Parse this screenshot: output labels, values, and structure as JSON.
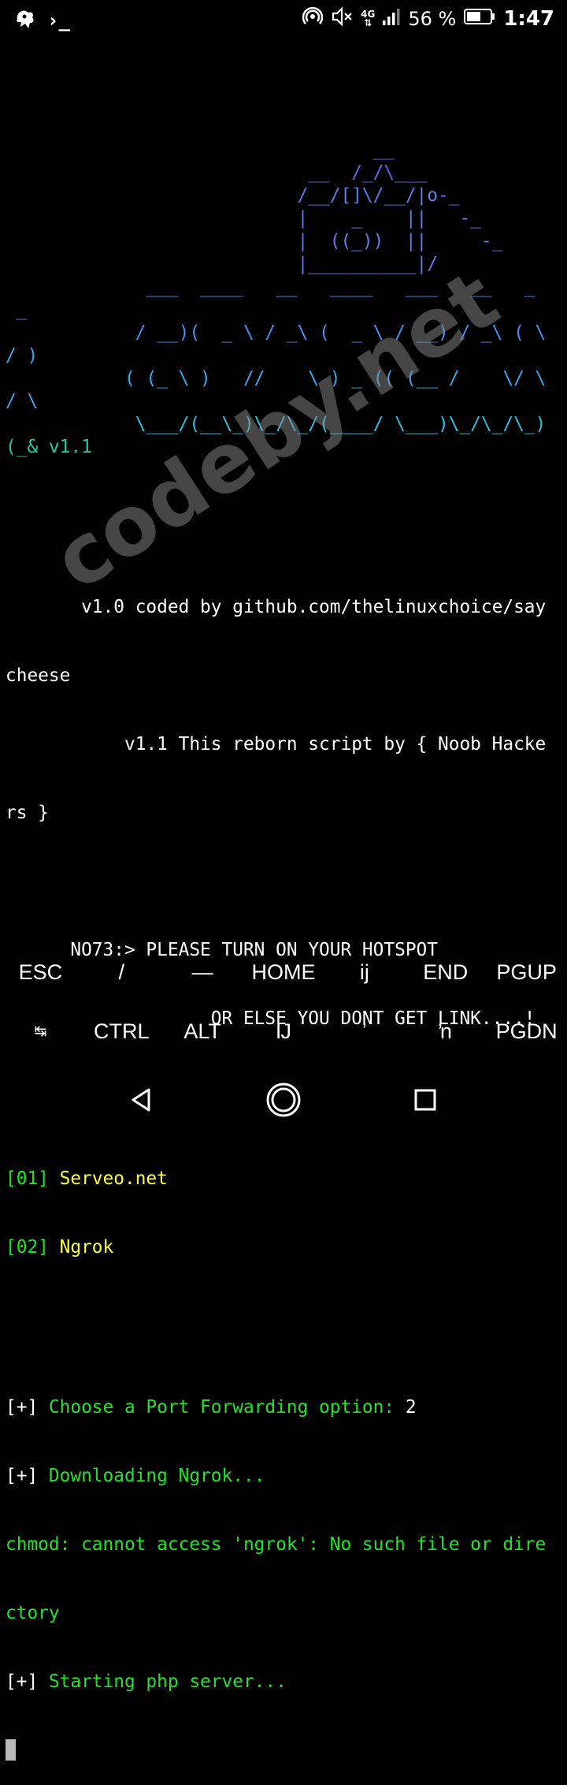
{
  "status_bar": {
    "network_top": "4G",
    "network_bottom": "⇅",
    "battery_percent": "56 %",
    "time": "1:47",
    "prompt_glyph": "›_"
  },
  "ascii_art": [
    {
      "text": "                                  __",
      "cls": "art-purple"
    },
    {
      "text": "                            __  /_/\\___",
      "cls": "art-purple"
    },
    {
      "text": "                           /__/[]\\/__/|o-_",
      "cls": "art-blue"
    },
    {
      "text": "                           |    _    ||   -_",
      "cls": "art-blue"
    },
    {
      "text": "                           |  ((_))  ||     -_",
      "cls": "art-blue"
    },
    {
      "text": "                           |__________|/",
      "cls": "art-blue"
    },
    {
      "text": "             ___  ____   __   ____   ___   __   _",
      "cls": "art-cyan1"
    },
    {
      "text": " _",
      "cls": "art-cyan1"
    },
    {
      "text": "            / __)(  _ \\ / _\\ (  _ \\ / __) / _\\ ( \\",
      "cls": "art-cyan1"
    },
    {
      "text": "/ )",
      "cls": "art-cyan2"
    },
    {
      "text": "           ( (_ \\ )   //    \\ ) _ (( (__ /    \\/ \\",
      "cls": "art-cyan2"
    },
    {
      "text": "/ \\",
      "cls": "art-cyan2"
    },
    {
      "text": "            \\___/(__\\_)\\_/\\_/(____/ \\___)\\_/\\_/\\_)",
      "cls": "art-cyan3"
    },
    {
      "text": "(_& v1.1",
      "cls": "teal"
    }
  ],
  "credits": [
    "       v1.0 coded by github.com/thelinuxchoice/say",
    "cheese",
    "           v1.1 This reborn script by { Noob Hacke",
    "rs }"
  ],
  "notice": [
    "      NO73:> PLEASE TURN ON YOUR HOTSPOT",
    "                   OR ELSE YOU DONT GET LINK....!"
  ],
  "menu": [
    {
      "num": "[01]",
      "label": " Serveo.net"
    },
    {
      "num": "[02]",
      "label": " Ngrok"
    }
  ],
  "log": {
    "choose_prefix": "[+]",
    "choose_text": " Choose a Port Forwarding option: ",
    "choose_value": "2",
    "download_prefix": "[+]",
    "download_text": " Downloading Ngrok...",
    "error_line1": "chmod: cannot access 'ngrok': No such file or dire",
    "error_line2": "ctory",
    "start_prefix": "[+]",
    "start_text": " Starting php server..."
  },
  "watermark": "codeby.net",
  "extra_keys": {
    "row1": [
      "ESC",
      "/",
      "—",
      "HOME",
      "ĳ",
      "END",
      "PGUP"
    ],
    "row2": [
      "↹",
      "CTRL",
      "ALT",
      "Ĳ",
      "ʼ",
      "ŉ",
      "PGDN"
    ]
  }
}
